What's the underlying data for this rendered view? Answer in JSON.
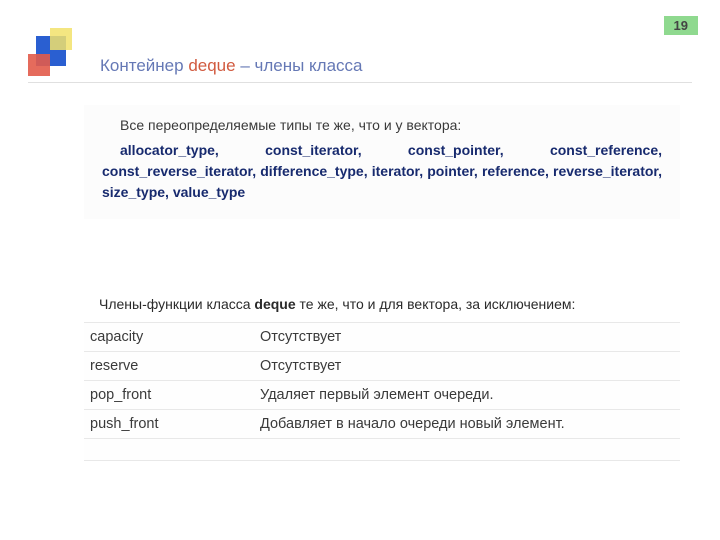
{
  "page_number": "19",
  "title": {
    "prefix": "Контейнер ",
    "accent": "deque ",
    "suffix": " – члены класса"
  },
  "types_block": {
    "intro": "Все переопределяемые типы те же, что и у вектора:",
    "list": "allocator_type,  const_iterator,  const_pointer,  const_reference, const_reverse_iterator,  difference_type,  iterator,  pointer,  reference, reverse_iterator,   size_type,   value_type"
  },
  "funcs_intro": {
    "before": "Члены-функции класса ",
    "bold": "deque",
    "after": " те же, что и для вектора, за исключением:"
  },
  "func_table": [
    {
      "name": "capacity",
      "desc": "Отсутствует"
    },
    {
      "name": "reserve",
      "desc": "Отсутствует"
    },
    {
      "name": "pop_front",
      "desc": "Удаляет первый элемент очереди."
    },
    {
      "name": "push_front",
      "desc": "Добавляет в начало очереди новый элемент."
    }
  ]
}
